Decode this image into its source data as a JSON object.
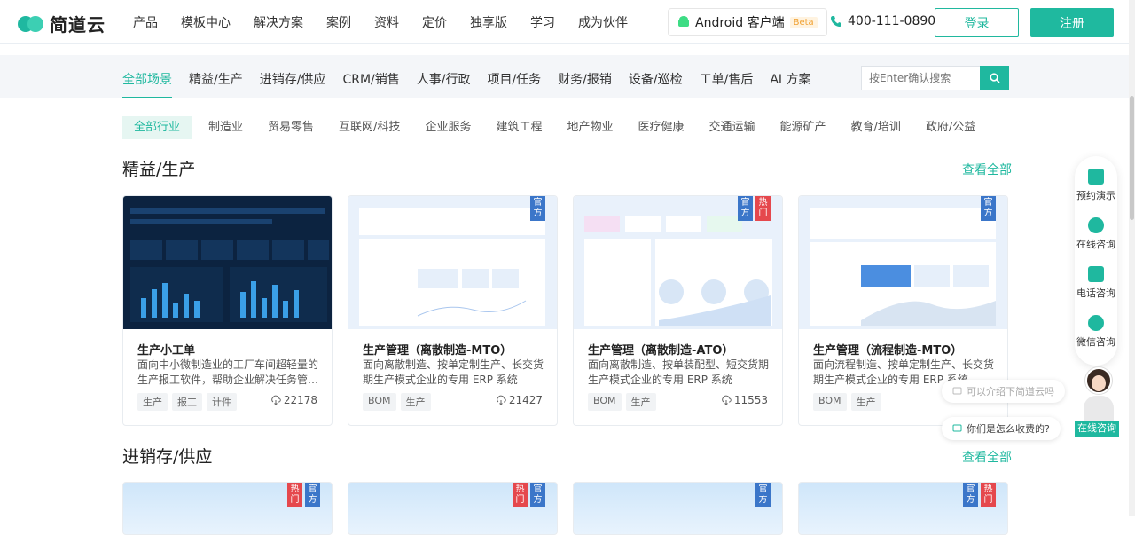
{
  "header": {
    "brand": "简道云",
    "nav": [
      "产品",
      "模板中心",
      "解决方案",
      "案例",
      "资料",
      "定价",
      "独享版",
      "学习",
      "成为伙伴"
    ],
    "android_label": "Android 客户端",
    "beta": "Beta",
    "phone": "400-111-0890",
    "login": "登录",
    "register": "注册"
  },
  "scenes": {
    "items": [
      "全部场景",
      "精益/生产",
      "进销存/供应",
      "CRM/销售",
      "人事/行政",
      "项目/任务",
      "财务/报销",
      "设备/巡检",
      "工单/售后",
      "AI 方案"
    ],
    "active": 0,
    "search_placeholder": "按Enter确认搜索"
  },
  "industries": {
    "items": [
      "全部行业",
      "制造业",
      "贸易零售",
      "互联网/科技",
      "企业服务",
      "建筑工程",
      "地产物业",
      "医疗健康",
      "交通运输",
      "能源矿产",
      "教育/培训",
      "政府/公益"
    ],
    "active": 0
  },
  "sections": [
    {
      "title": "精益/生产",
      "see_all": "查看全部",
      "cards": [
        {
          "title": "生产小工单",
          "desc": "面向中小微制造业的工厂车间超轻量的生产报工软件，帮助企业解决任务管…",
          "tags": [
            "生产",
            "报工",
            "计件"
          ],
          "downloads": "22178",
          "ribbons": []
        },
        {
          "title": "生产管理（离散制造-MTO）",
          "desc": "面向离散制造、按单定制生产、长交货期生产模式企业的专用 ERP 系统",
          "tags": [
            "BOM",
            "生产"
          ],
          "downloads": "21427",
          "ribbons": [
            "官方"
          ]
        },
        {
          "title": "生产管理（离散制造-ATO）",
          "desc": "面向离散制造、按单装配型、短交货期生产模式企业的专用 ERP 系统",
          "tags": [
            "BOM",
            "生产"
          ],
          "downloads": "11553",
          "ribbons": [
            "官方",
            "热门"
          ]
        },
        {
          "title": "生产管理（流程制造-MTO）",
          "desc": "面向流程制造、按单定制生产、长交货期生产模式企业的专用 ERP 系统",
          "tags": [
            "BOM",
            "生产"
          ],
          "downloads": "",
          "ribbons": [
            "官方"
          ]
        }
      ]
    },
    {
      "title": "进销存/供应",
      "see_all": "查看全部",
      "card_ribbons": [
        [
          "热门",
          "官方"
        ],
        [
          "热门",
          "官方"
        ],
        [
          "官方"
        ],
        [
          "官方",
          "热门"
        ]
      ]
    }
  ],
  "side_tools": [
    "预约演示",
    "在线咨询",
    "电话咨询",
    "微信咨询"
  ],
  "chat": {
    "prompt1": "可以介绍下简道云吗",
    "prompt2": "你们是怎么收费的?",
    "online_label": "在线咨询"
  },
  "colors": {
    "accent": "#1fb89f",
    "official": "#3b76c9",
    "hot": "#e5484d"
  }
}
